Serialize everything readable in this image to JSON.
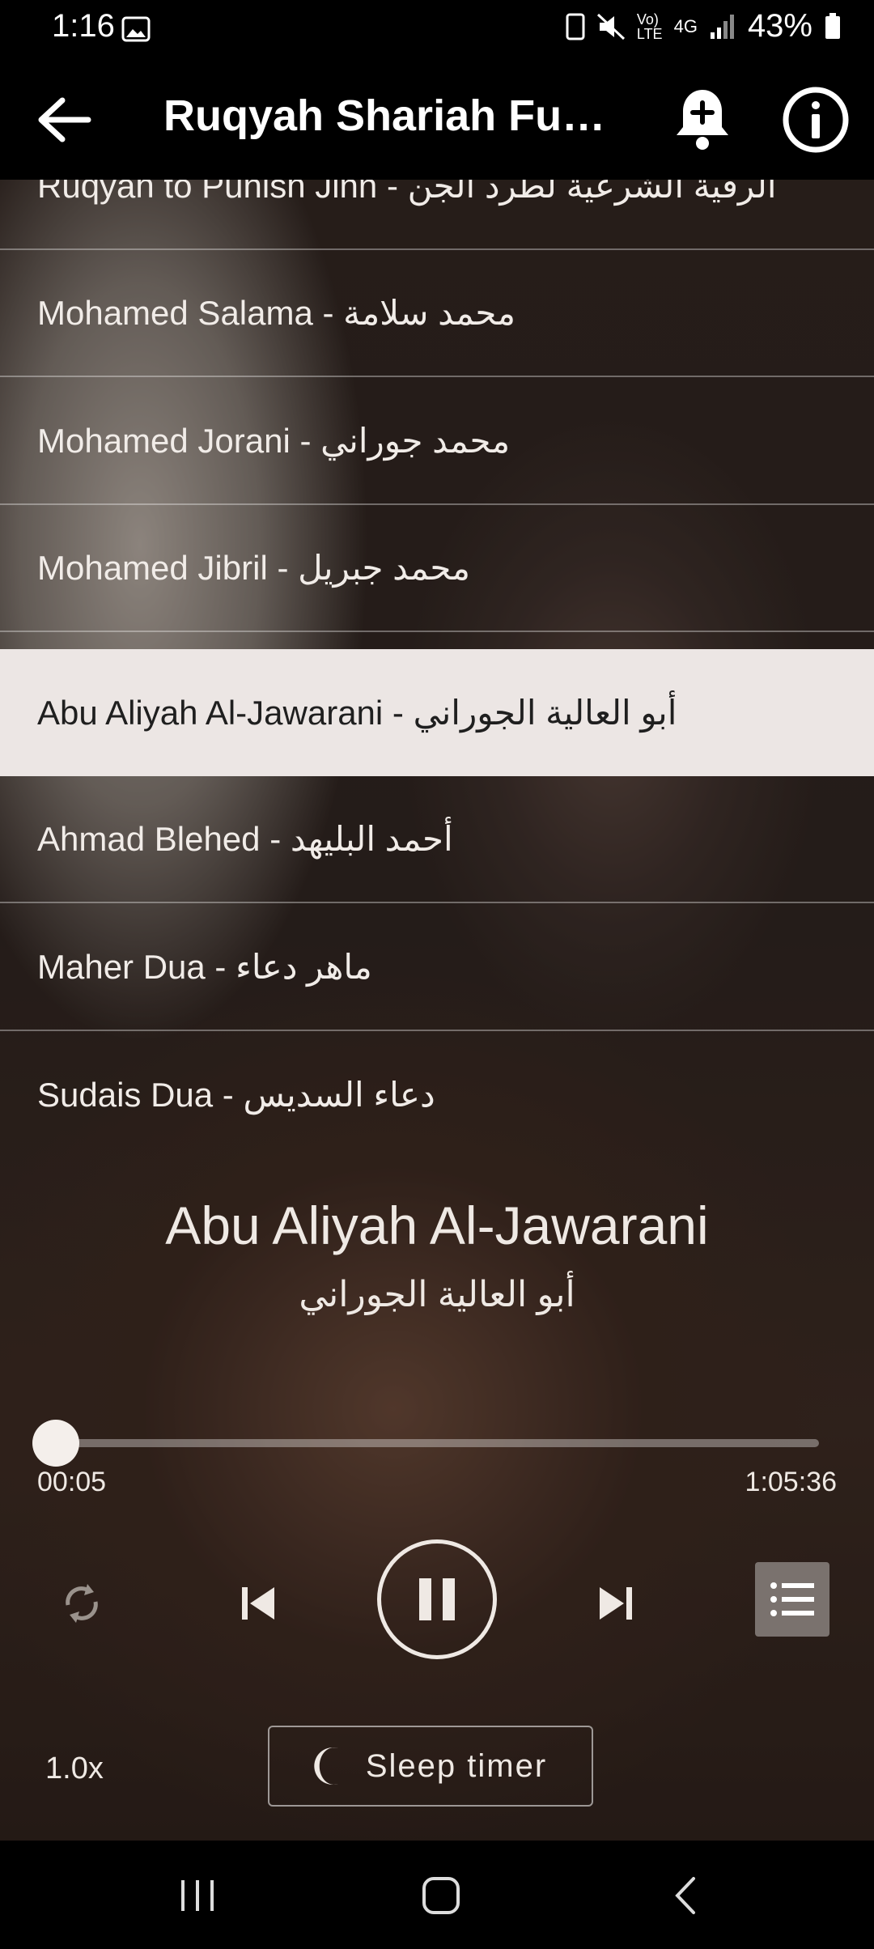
{
  "status_bar": {
    "time": "1:16",
    "battery": "43%",
    "network": "4G"
  },
  "app_bar": {
    "title": "Ruqyah Shariah Full..."
  },
  "playlist": [
    {
      "en": "Ruqyah to Punish Jinn",
      "ar": "الرقية الشرعية لطرد الجن",
      "active": false
    },
    {
      "en": "Mohamed Salama",
      "ar": "محمد سلامة",
      "active": false
    },
    {
      "en": "Mohamed Jorani",
      "ar": "محمد جوراني",
      "active": false
    },
    {
      "en": "Mohamed Jibril",
      "ar": "محمد جبريل",
      "active": false
    },
    {
      "en": "Abu Aliyah Al-Jawarani",
      "ar": "أبو العالية الجوراني",
      "active": true
    },
    {
      "en": "Ahmad Blehed",
      "ar": "أحمد البليهد",
      "active": false
    },
    {
      "en": "Maher Dua",
      "ar": "ماهر دعاء",
      "active": false
    },
    {
      "en": "Sudais Dua",
      "ar": "دعاء السديس",
      "active": false
    }
  ],
  "now_playing": {
    "title": "Abu Aliyah Al-Jawarani",
    "subtitle": "أبو العالية الجوراني"
  },
  "player": {
    "elapsed": "00:05",
    "total": "1:05:36",
    "progress": 0.0013,
    "speed": "1.0x",
    "sleep_timer": "Sleep timer"
  },
  "icons": [
    "back-arrow-icon",
    "add-alarm-icon",
    "info-icon",
    "repeat-icon",
    "previous-icon",
    "pause-icon",
    "next-icon",
    "playlist-icon",
    "moon-icon"
  ],
  "colors": {
    "active_row_bg": "#ece6e4",
    "bar_bg": "#000000",
    "text": "#efe9e4"
  }
}
